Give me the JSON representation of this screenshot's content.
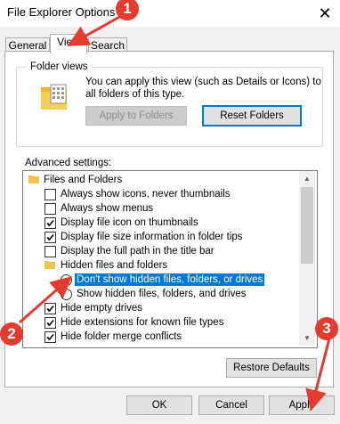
{
  "window": {
    "title": "File Explorer Options",
    "close_glyph": "✕"
  },
  "tabs": [
    {
      "label": "General",
      "active": false
    },
    {
      "label": "View",
      "active": true
    },
    {
      "label": "Search",
      "active": false
    }
  ],
  "folder_views": {
    "title": "Folder views",
    "description_line1": "You can apply this view (such as Details or Icons) to",
    "description_line2": "all folders of this type.",
    "apply_button": "Apply to Folders",
    "reset_button": "Reset Folders",
    "icon": "folder-view-icon"
  },
  "advanced": {
    "label": "Advanced settings:",
    "items": [
      {
        "kind": "folder",
        "label": "Files and Folders"
      },
      {
        "kind": "checkbox",
        "label": "Always show icons, never thumbnails",
        "checked": false
      },
      {
        "kind": "checkbox",
        "label": "Always show menus",
        "checked": false
      },
      {
        "kind": "checkbox",
        "label": "Display file icon on thumbnails",
        "checked": true
      },
      {
        "kind": "checkbox",
        "label": "Display file size information in folder tips",
        "checked": true
      },
      {
        "kind": "checkbox",
        "label": "Display the full path in the title bar",
        "checked": false
      },
      {
        "kind": "folder",
        "label": "Hidden files and folders"
      },
      {
        "kind": "radio",
        "label": "Don't show hidden files, folders, or drives",
        "checked": true,
        "selected": true
      },
      {
        "kind": "radio",
        "label": "Show hidden files, folders, and drives",
        "checked": false
      },
      {
        "kind": "checkbox",
        "label": "Hide empty drives",
        "checked": true
      },
      {
        "kind": "checkbox",
        "label": "Hide extensions for known file types",
        "checked": true
      },
      {
        "kind": "checkbox",
        "label": "Hide folder merge conflicts",
        "checked": true
      }
    ]
  },
  "restore_button": "Restore Defaults",
  "footer": {
    "ok": "OK",
    "cancel": "Cancel",
    "apply": "Apply"
  },
  "annotations": [
    "1",
    "2",
    "3"
  ],
  "colors": {
    "accent": "#0078d7",
    "annotation_red": "#e33b2e",
    "folder_yellow": "#f0c44a"
  }
}
